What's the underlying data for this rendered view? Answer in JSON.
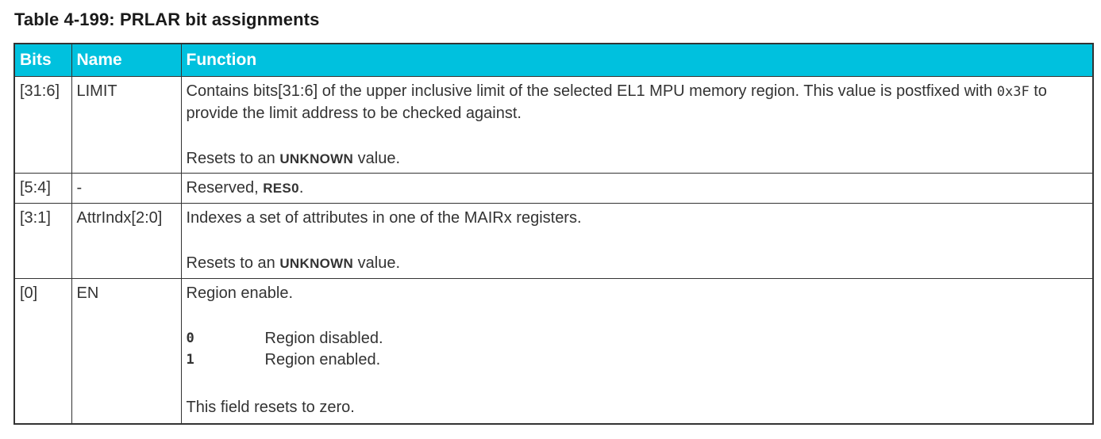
{
  "caption": "Table 4-199: PRLAR bit assignments",
  "headers": {
    "bits": "Bits",
    "name": "Name",
    "function": "Function"
  },
  "rows": [
    {
      "bits": "[31:6]",
      "name": "LIMIT",
      "func_pre": "Contains bits[31:6] of the upper inclusive limit of the selected EL1 MPU memory region. This value is postfixed with ",
      "func_code": "0x3F",
      "func_post": " to provide the limit address to be checked against.",
      "reset_pre": "Resets to an ",
      "reset_keyword": "UNKNOWN",
      "reset_post": " value."
    },
    {
      "bits": "[5:4]",
      "name": "-",
      "func_pre": "Reserved, ",
      "func_keyword": "RES0",
      "func_post": "."
    },
    {
      "bits": "[3:1]",
      "name": "AttrIndx[2:0]",
      "func": "Indexes a set of attributes in one of the MAIRx registers.",
      "reset_pre": "Resets to an ",
      "reset_keyword": "UNKNOWN",
      "reset_post": " value."
    },
    {
      "bits": "[0]",
      "name": "EN",
      "func": "Region enable.",
      "enum": [
        {
          "value": "0",
          "meaning": "Region disabled."
        },
        {
          "value": "1",
          "meaning": "Region enabled."
        }
      ],
      "reset": "This field resets to zero."
    }
  ]
}
